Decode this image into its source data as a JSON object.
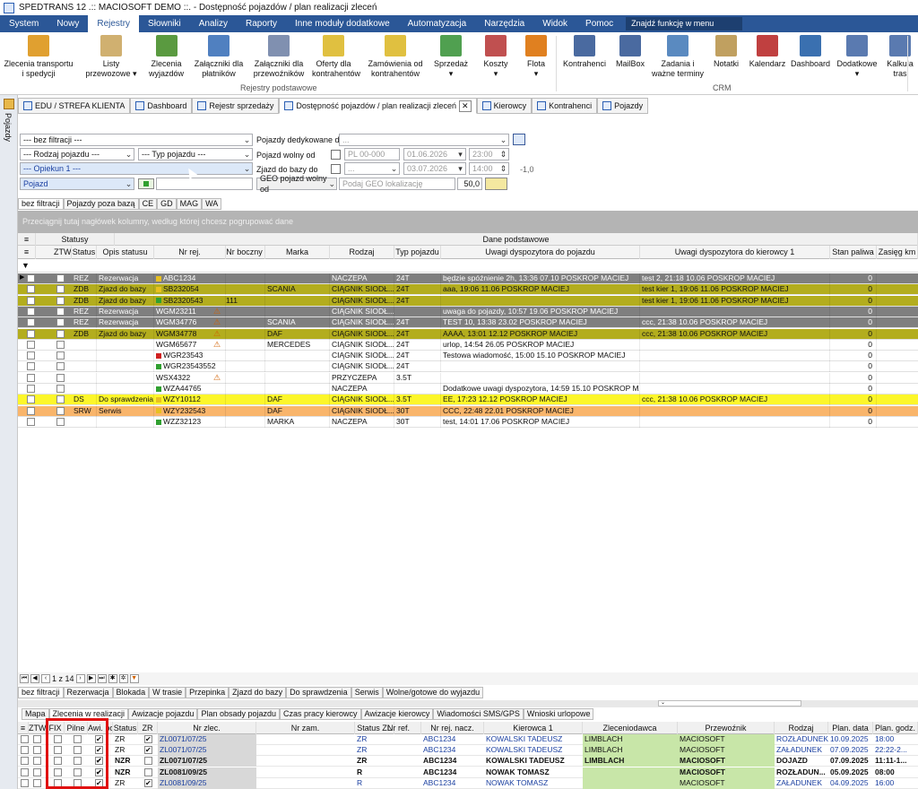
{
  "window": {
    "title": "SPEDTRANS 12 .:: MACIOSOFT DEMO ::. - Dostępność pojazdów / plan realizacji zleceń"
  },
  "menu": {
    "items": [
      "System",
      "Nowy",
      "Rejestry",
      "Słowniki",
      "Analizy",
      "Raporty",
      "Inne moduły dodatkowe",
      "Automatyzacja",
      "Narzędzia",
      "Widok",
      "Pomoc"
    ],
    "active": "Rejestry",
    "find_placeholder": "Znajdź funkcję w menu"
  },
  "ribbon": {
    "buttons": [
      {
        "l1": "Zlecenia transportu",
        "l2": "i spedycji",
        "icon": "truck-icon",
        "color": "#e0a030"
      },
      {
        "l1": "Listy",
        "l2": "przewozowe ▾",
        "icon": "list-icon",
        "color": "#d0b070"
      },
      {
        "l1": "Zlecenia",
        "l2": "wyjazdów",
        "icon": "calendar-icon",
        "color": "#5a9a40"
      },
      {
        "l1": "Załączniki dla",
        "l2": "płatników",
        "icon": "attachment-icon",
        "color": "#5080c0"
      },
      {
        "l1": "Załączniki dla",
        "l2": "przewoźników",
        "icon": "attachment-icon",
        "color": "#8090b0"
      },
      {
        "l1": "Oferty dla",
        "l2": "kontrahentów",
        "icon": "offer-icon",
        "color": "#e0c040"
      },
      {
        "l1": "Zamówienia od",
        "l2": "kontrahentów",
        "icon": "order-icon",
        "color": "#e0c040"
      },
      {
        "l1": "Sprzedaż",
        "l2": "▾",
        "icon": "sales-icon",
        "color": "#50a050"
      },
      {
        "l1": "Koszty",
        "l2": "▾",
        "icon": "costs-icon",
        "color": "#c05050"
      },
      {
        "l1": "Flota",
        "l2": "▾",
        "icon": "fleet-icon",
        "color": "#e08020"
      },
      {
        "l1": "Kontrahenci",
        "l2": "",
        "icon": "contacts-icon",
        "color": "#4a6aa0"
      },
      {
        "l1": "MailBox",
        "l2": "",
        "icon": "mailbox-icon",
        "color": "#4a6aa0"
      },
      {
        "l1": "Zadania i",
        "l2": "ważne terminy",
        "icon": "tasks-icon",
        "color": "#5a8ac0"
      },
      {
        "l1": "Notatki",
        "l2": "",
        "icon": "notes-icon",
        "color": "#c0a060"
      },
      {
        "l1": "Kalendarz",
        "l2": "",
        "icon": "calendar-icon",
        "color": "#c04040"
      },
      {
        "l1": "Dashboard",
        "l2": "",
        "icon": "dashboard-icon",
        "color": "#3a70b0"
      },
      {
        "l1": "Dodatkowe",
        "l2": "▾",
        "icon": "extra-icon",
        "color": "#5a7ab0"
      },
      {
        "l1": "Kalkula",
        "l2": "tras",
        "icon": "calculator-icon",
        "color": "#5a7ab0"
      }
    ],
    "group_rejestry": "Rejestry podstawowe",
    "group_crm": "CRM"
  },
  "sidebar": {
    "label": "Pojazdy"
  },
  "doc_tabs": [
    "EDU / STREFA KLIENTA",
    "Dashboard",
    "Rejestr sprzedaży",
    "Dostępność pojazdów / plan realizacji zleceń",
    "Kierowcy",
    "Kontrahenci",
    "Pojazdy"
  ],
  "filters": {
    "f1": "--- bez filtracji ---",
    "f2": "--- Rodzaj pojazdu ---",
    "f3": "--- Typ pojazdu ---",
    "f4": "--- Opiekun 1 ---",
    "f5": "Pojazd",
    "lbl_dedykowane": "Pojazdy dedykowane dla",
    "ded_val": "...",
    "lbl_wolny": "Pojazd wolny od",
    "wolny_country": "PL 00-000",
    "wolny_date": "01.06.2026",
    "wolny_time": "23:00",
    "lbl_zjazd": "Zjazd do bazy do",
    "zjazd_val": "...",
    "zjazd_date": "03.07.2026",
    "zjazd_time": "14:00",
    "zjazd_num": "-1,0",
    "geo_label": "GEO pojazd wolny od",
    "geo_placeholder": "Podaj GEO lokalizację",
    "geo_num": "50,0"
  },
  "sub_tabs": [
    "bez filtracji",
    "Pojazdy poza bazą",
    "CE",
    "GD",
    "MAG",
    "WA"
  ],
  "group_hint": "Przeciągnij tutaj nagłówek kolumny, według której chcesz pogrupować dane",
  "grid": {
    "band_statusy": "Statusy",
    "band_dane": "Dane podstawowe",
    "headers": [
      "ZTW",
      "Status",
      "Opis statusu",
      "Nr rej.",
      "Nr boczny",
      "Marka",
      "Rodzaj",
      "Typ pojazdu",
      "Uwagi dyspozytora do pojazdu",
      "Uwagi dyspozytora do kierowcy 1",
      "Stan paliwa",
      "Zasięg km"
    ],
    "rows": [
      {
        "style": "gray",
        "status": "REZ",
        "opis": "Rezerwacja",
        "flag": "#e8c020",
        "nr": "ABC1234",
        "boczny": "",
        "marka": "",
        "rodzaj": "NACZEPA",
        "typ": "24T",
        "uw1": "będzie spóźnienie 2h, 13:36 07.10 POSKROP MACIEJ",
        "uw2": "test 2, 21:18 10.06 POSKROP MACIEJ",
        "paliwo": "0",
        "warn": false
      },
      {
        "style": "olive",
        "status": "ZDB",
        "opis": "Zjazd do bazy",
        "flag": "#e8c020",
        "nr": "SB232054",
        "boczny": "",
        "marka": "SCANIA",
        "rodzaj": "CIĄGNIK SIODŁ...",
        "typ": "24T",
        "uw1": "aaa, 19:06 11.06 POSKROP MACIEJ",
        "uw2": "test kier 1, 19:06 11.06 POSKROP MACIEJ",
        "paliwo": "0",
        "warn": false
      },
      {
        "style": "olive",
        "status": "ZDB",
        "opis": "Zjazd do bazy",
        "flag": "#30a030",
        "nr": "SB2320543",
        "boczny": "111",
        "marka": "",
        "rodzaj": "CIĄGNIK SIODŁ...",
        "typ": "24T",
        "uw1": "",
        "uw2": "test kier 1, 19:06 11.06 POSKROP MACIEJ",
        "paliwo": "0",
        "warn": false
      },
      {
        "style": "gray",
        "status": "REZ",
        "opis": "Rezerwacja",
        "flag": "",
        "nr": "WGM23211",
        "boczny": "",
        "marka": "",
        "rodzaj": "CIĄGNIK SIODŁ...",
        "typ": "",
        "uw1": "uwaga do pojazdy, 10:57 19.06 POSKROP MACIEJ",
        "uw2": "",
        "paliwo": "0",
        "warn": true
      },
      {
        "style": "gray",
        "status": "REZ",
        "opis": "Rezerwacja",
        "flag": "",
        "nr": "WGM34776",
        "boczny": "",
        "marka": "SCANIA",
        "rodzaj": "CIĄGNIK SIODŁ...",
        "typ": "24T",
        "uw1": "TEST 10, 13:38 23.02 POSKROP MACIEJ",
        "uw2": "ccc, 21:38 10.06 POSKROP MACIEJ",
        "paliwo": "0",
        "warn": true
      },
      {
        "style": "olive",
        "status": "ZDB",
        "opis": "Zjazd do bazy",
        "flag": "",
        "nr": "WGM34778",
        "boczny": "",
        "marka": "DAF",
        "rodzaj": "CIĄGNIK SIODŁ...",
        "typ": "24T",
        "uw1": "AAAA, 13:01 12.12 POSKROP MACIEJ",
        "uw2": "ccc, 21:38 10.06 POSKROP MACIEJ",
        "paliwo": "0",
        "warn": true
      },
      {
        "style": "white",
        "status": "",
        "opis": "",
        "flag": "",
        "nr": "WGM65677",
        "boczny": "",
        "marka": "MERCEDES",
        "rodzaj": "CIĄGNIK SIODŁ...",
        "typ": "24T",
        "uw1": "urlop, 14:54 26.05 POSKROP MACIEJ",
        "uw2": "",
        "paliwo": "0",
        "warn": true
      },
      {
        "style": "white",
        "status": "",
        "opis": "",
        "flag": "#d02020",
        "nr": "WGR23543",
        "boczny": "",
        "marka": "",
        "rodzaj": "CIĄGNIK SIODŁ...",
        "typ": "24T",
        "uw1": "Testowa wiadomość, 15:00 15.10 POSKROP MACIEJ",
        "uw2": "",
        "paliwo": "0",
        "warn": false
      },
      {
        "style": "white",
        "status": "",
        "opis": "",
        "flag": "#30a030",
        "nr": "WGR23543552",
        "boczny": "",
        "marka": "",
        "rodzaj": "CIĄGNIK SIODŁ...",
        "typ": "24T",
        "uw1": "",
        "uw2": "",
        "paliwo": "0",
        "warn": false
      },
      {
        "style": "white",
        "status": "",
        "opis": "",
        "flag": "",
        "nr": "WSX4322",
        "boczny": "",
        "marka": "",
        "rodzaj": "PRZYCZEPA",
        "typ": "3.5T",
        "uw1": "",
        "uw2": "",
        "paliwo": "0",
        "warn": true
      },
      {
        "style": "white",
        "status": "",
        "opis": "",
        "flag": "#30a030",
        "nr": "WZA44765",
        "boczny": "",
        "marka": "",
        "rodzaj": "NACZEPA",
        "typ": "",
        "uw1": "Dodatkowe uwagi dyspozytora, 14:59 15.10 POSKROP MA...",
        "uw2": "",
        "paliwo": "0",
        "warn": false
      },
      {
        "style": "yellow",
        "status": "DS",
        "opis": "Do sprawdzenia",
        "flag": "#e8c020",
        "nr": "WZY10112",
        "boczny": "",
        "marka": "DAF",
        "rodzaj": "CIĄGNIK SIODŁ...",
        "typ": "3.5T",
        "uw1": "EE, 17:23 12.12 POSKROP MACIEJ",
        "uw2": "ccc, 21:38 10.06 POSKROP MACIEJ",
        "paliwo": "0",
        "warn": false
      },
      {
        "style": "orange",
        "status": "SRW",
        "opis": "Serwis",
        "flag": "#e8c020",
        "nr": "WZY232543",
        "boczny": "",
        "marka": "DAF",
        "rodzaj": "CIĄGNIK SIODŁ...",
        "typ": "30T",
        "uw1": "CCC, 22:48 22.01 POSKROP MACIEJ",
        "uw2": "",
        "paliwo": "0",
        "warn": false
      },
      {
        "style": "white",
        "status": "",
        "opis": "",
        "flag": "#30a030",
        "nr": "WZZ32123",
        "boczny": "",
        "marka": "MARKA",
        "rodzaj": "NACZEPA",
        "typ": "30T",
        "uw1": "test, 14:01 17.06 POSKROP MACIEJ",
        "uw2": "",
        "paliwo": "0",
        "warn": false
      }
    ]
  },
  "pager": {
    "text": "1 z 14"
  },
  "filter_tabs": [
    "bez filtracji",
    "Rezerwacja",
    "Blokada",
    "W trasie",
    "Przepinka",
    "Zjazd do bazy",
    "Do sprawdzenia",
    "Serwis",
    "Wolne/gotowe do wyjazdu"
  ],
  "bottom_tabs": [
    "Mapa",
    "Zlecenia w realizacji",
    "Awizacje pojazdu",
    "Plan obsady pojazdu",
    "Czas pracy kierowcy",
    "Awizacje kierowcy",
    "Wiadomości SMS/GPS",
    "Wnioski urlopowe"
  ],
  "bottom_grid": {
    "headers": [
      "ZTW",
      "FIX",
      "Pilne",
      "Awi. poj.",
      "Status",
      "ZR",
      "Nr zlec.",
      "Nr zam.",
      "Status ZL",
      "Nr ref.",
      "Nr rej. nacz.",
      "Kierowca 1",
      "Zleceniodawca",
      "Przewoźnik",
      "Rodzaj",
      "Plan. data",
      "Plan. godz."
    ],
    "rows": [
      {
        "awi": true,
        "status": "ZR",
        "zr": true,
        "nr": "ZL0071/07/25",
        "szl": "ZR",
        "rej": "ABC1234",
        "kier": "KOWALSKI TADEUSZ",
        "zlec": "LIMBLACH",
        "przew": "MACIOSOFT",
        "rodzaj": "ROZŁADUNEK",
        "data": "10.09.2025",
        "godz": "18:00",
        "bold": false,
        "blue": true
      },
      {
        "awi": true,
        "status": "ZR",
        "zr": true,
        "nr": "ZL0071/07/25",
        "szl": "ZR",
        "rej": "ABC1234",
        "kier": "KOWALSKI TADEUSZ",
        "zlec": "LIMBLACH",
        "przew": "MACIOSOFT",
        "rodzaj": "ZAŁADUNEK",
        "data": "07.09.2025",
        "godz": "22:22-2...",
        "bold": false,
        "blue": true
      },
      {
        "awi": true,
        "status": "NZR",
        "zr": false,
        "nr": "ZL0071/07/25",
        "szl": "ZR",
        "rej": "ABC1234",
        "kier": "KOWALSKI TADEUSZ",
        "zlec": "LIMBLACH",
        "przew": "MACIOSOFT",
        "rodzaj": "DOJAZD",
        "data": "07.09.2025",
        "godz": "11:11-1...",
        "bold": true,
        "blue": false
      },
      {
        "awi": true,
        "status": "NZR",
        "zr": false,
        "nr": "ZL0081/09/25",
        "szl": "R",
        "rej": "ABC1234",
        "kier": "NOWAK TOMASZ",
        "zlec": "",
        "przew": "MACIOSOFT",
        "rodzaj": "ROZŁADUN...",
        "data": "05.09.2025",
        "godz": "08:00",
        "bold": true,
        "blue": false
      },
      {
        "awi": true,
        "status": "ZR",
        "zr": true,
        "nr": "ZL0081/09/25",
        "szl": "R",
        "rej": "ABC1234",
        "kier": "NOWAK TOMASZ",
        "zlec": "",
        "przew": "MACIOSOFT",
        "rodzaj": "ZAŁADUNEK",
        "data": "04.09.2025",
        "godz": "16:00",
        "bold": false,
        "blue": true
      }
    ]
  }
}
